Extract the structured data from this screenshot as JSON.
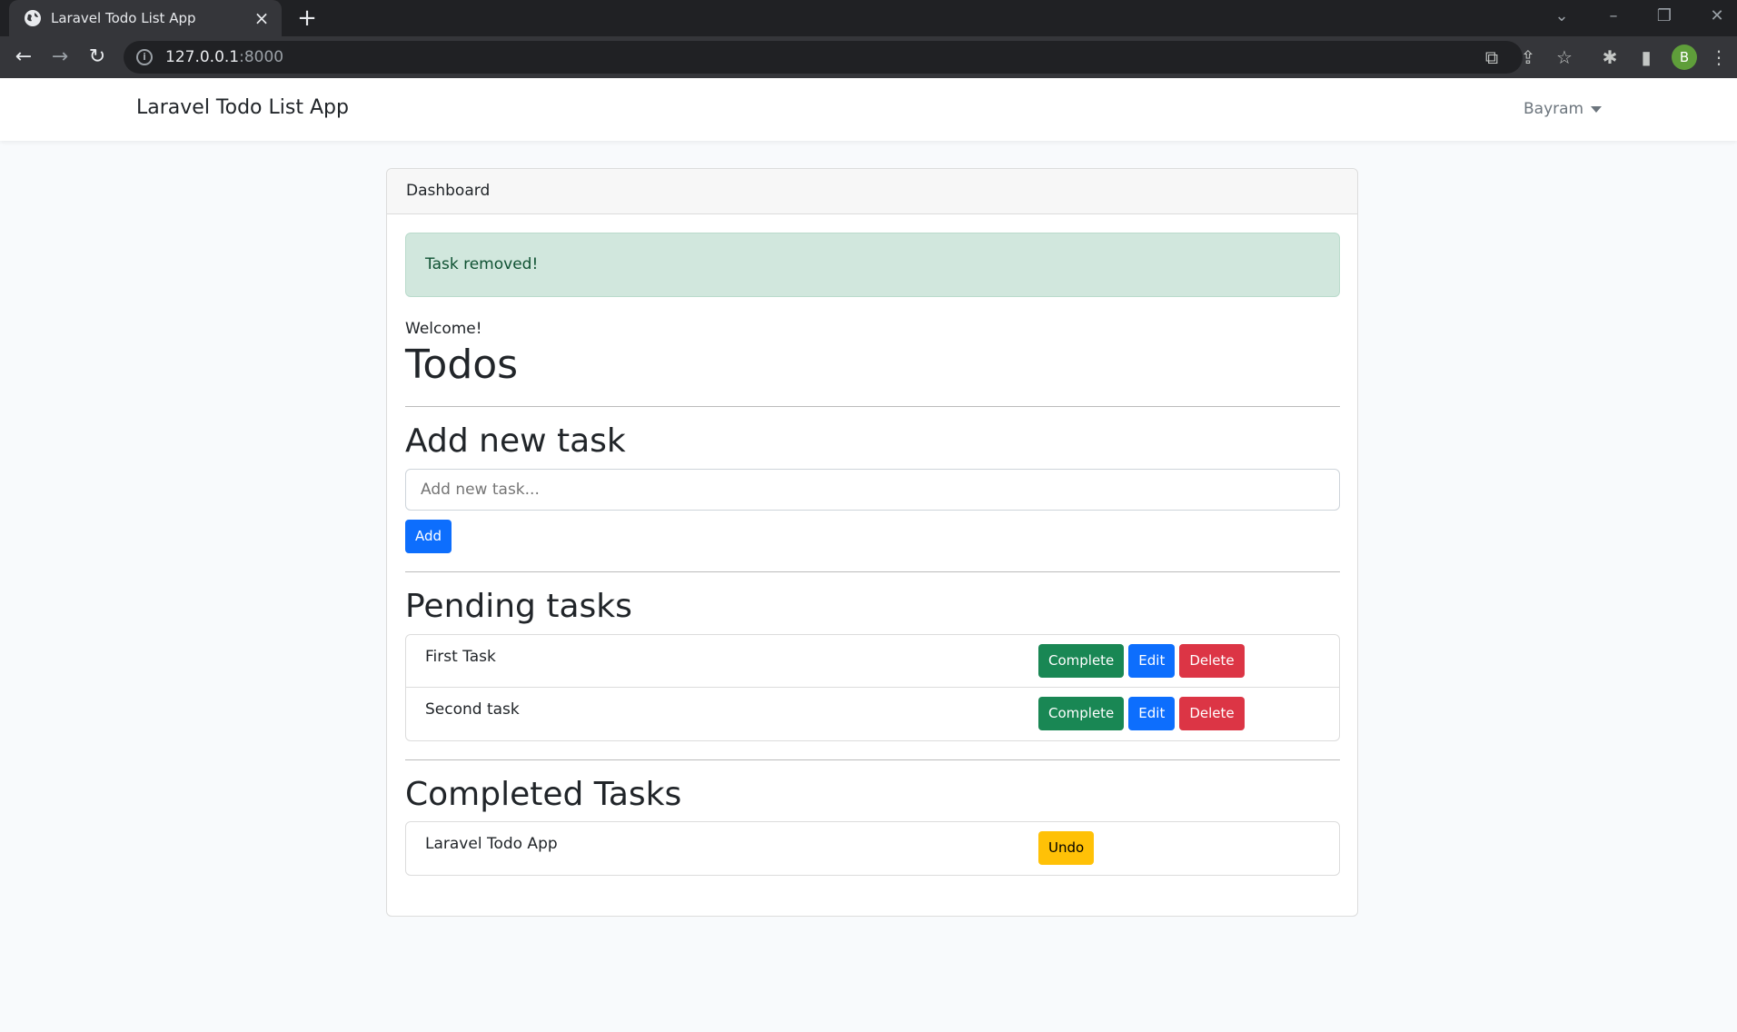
{
  "browser": {
    "tab_title": "Laravel Todo List App",
    "url_host": "127.0.0.1",
    "url_port": ":8000",
    "profile_initial": "B"
  },
  "navbar": {
    "brand": "Laravel Todo List App",
    "user": "Bayram"
  },
  "card": {
    "header": "Dashboard",
    "alert": "Task removed!",
    "welcome": "Welcome!",
    "title": "Todos"
  },
  "add_section": {
    "heading": "Add new task",
    "placeholder": "Add new task...",
    "button": "Add"
  },
  "pending": {
    "heading": "Pending tasks",
    "items": [
      {
        "text": "First Task",
        "complete": "Complete",
        "edit": "Edit",
        "delete": "Delete"
      },
      {
        "text": "Second task",
        "complete": "Complete",
        "edit": "Edit",
        "delete": "Delete"
      }
    ]
  },
  "completed": {
    "heading": "Completed Tasks",
    "items": [
      {
        "text": "Laravel Todo App",
        "undo": "Undo"
      }
    ]
  },
  "colors": {
    "primary": "#0d6efd",
    "success": "#198754",
    "danger": "#dc3545",
    "warning": "#ffc107",
    "alert_bg": "#d1e7dd"
  }
}
